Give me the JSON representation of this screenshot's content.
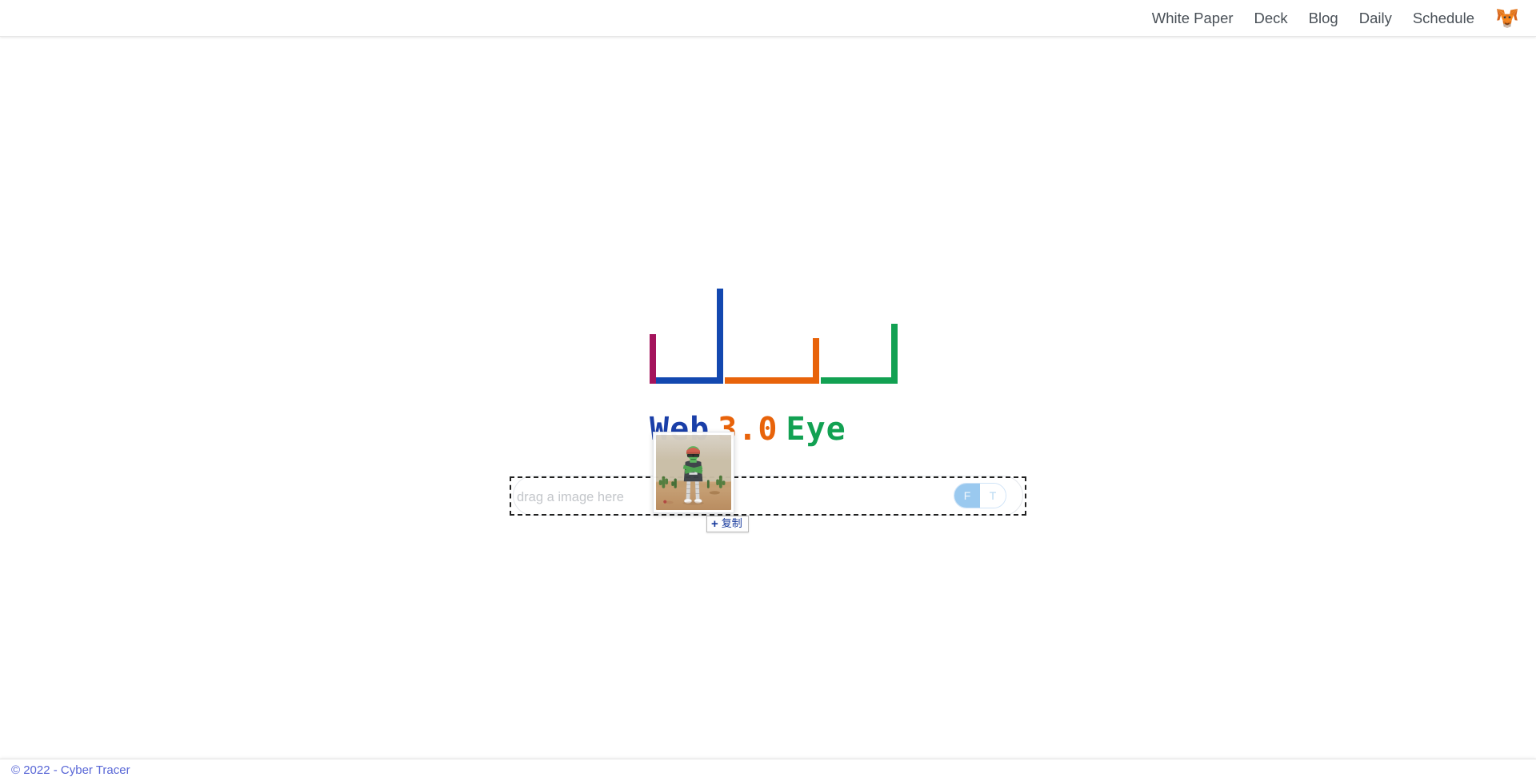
{
  "header": {
    "nav_items": [
      {
        "label": "White Paper",
        "name": "nav-white-paper"
      },
      {
        "label": "Deck",
        "name": "nav-deck"
      },
      {
        "label": "Blog",
        "name": "nav-blog"
      },
      {
        "label": "Daily",
        "name": "nav-daily"
      },
      {
        "label": "Schedule",
        "name": "nav-schedule"
      }
    ],
    "wallet_icon": "metamask-fox-icon",
    "text_color": "#495057"
  },
  "logo": {
    "icon_name": "web3-eye-bracket-logo",
    "segments": [
      {
        "color": "#a4145c",
        "role": "magenta-vertical"
      },
      {
        "color": "#1348b0",
        "role": "blue-vertical"
      },
      {
        "color": "#1348b0",
        "role": "blue-horizontal"
      },
      {
        "color": "#e8630a",
        "role": "orange-vertical"
      },
      {
        "color": "#e8630a",
        "role": "orange-horizontal"
      },
      {
        "color": "#12a152",
        "role": "green-vertical"
      },
      {
        "color": "#12a152",
        "role": "green-horizontal"
      }
    ],
    "wordmark": {
      "part1": "Web",
      "part2": "3.0",
      "part3": "Eye",
      "color1": "#1a3fa8",
      "color2": "#e8630a",
      "color3": "#12a152"
    }
  },
  "dropzone": {
    "placeholder": "drag a image here",
    "input_value": "",
    "state": "drag-over",
    "toggle": {
      "name": "ft-toggle",
      "left_label": "F",
      "right_label": "T",
      "selected": "F",
      "active_color": "#9ac9ef"
    }
  },
  "drag": {
    "ghost_image_name": "nft-character-desert-thumbnail",
    "tooltip_plus": "+",
    "tooltip_label": "复制",
    "tooltip_color": "#14379b"
  },
  "footer": {
    "copyright": "© 2022 - Cyber Tracer",
    "link_color": "#5866d6"
  }
}
